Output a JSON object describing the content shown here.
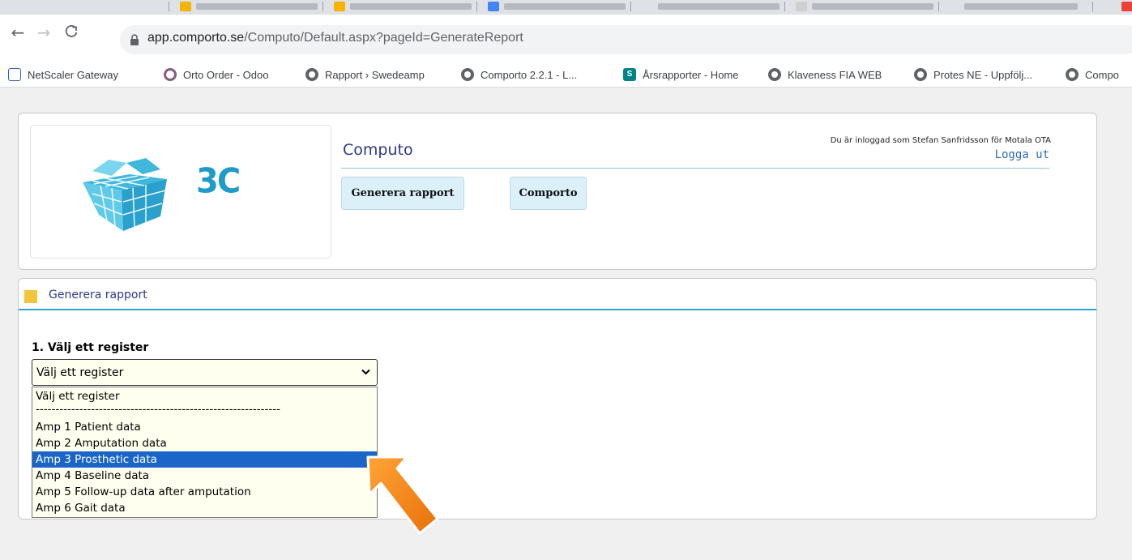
{
  "browser": {
    "url_host": "app.comporto.se",
    "url_path": "/Computo/Default.aspx?pageId=GenerateReport",
    "bookmarks": [
      {
        "label": "NetScaler Gateway",
        "icon": "netscaler-lock-icon"
      },
      {
        "label": "Orto Order - Odoo",
        "icon": "odoo-icon"
      },
      {
        "label": "Rapport › Swedeamp",
        "icon": "globe-icon"
      },
      {
        "label": "Comporto 2.2.1 - L...",
        "icon": "globe-icon"
      },
      {
        "label": "Årsrapporter - Home",
        "icon": "sharepoint-icon"
      },
      {
        "label": "Klaveness FIA WEB",
        "icon": "globe-icon"
      },
      {
        "label": "Protes NE - Uppfölj...",
        "icon": "globe-icon"
      },
      {
        "label": "Compo",
        "icon": "globe-icon"
      }
    ]
  },
  "header": {
    "logo_text": "3C",
    "app_title": "Computo",
    "login_info": "Du är inloggad som Stefan Sanfridsson för Motala OTA",
    "logout_label": "Logga ut",
    "nav": [
      {
        "label": "Generera rapport"
      },
      {
        "label": "Comporto"
      }
    ]
  },
  "report": {
    "panel_title": "Generera rapport",
    "step_label": "1. Välj ett register",
    "select_value": "Välj ett register",
    "options": [
      "Välj ett register",
      "--------------------------------------------------------------",
      "Amp 1 Patient data",
      "Amp 2 Amputation data",
      "Amp 3 Prosthetic data",
      "Amp 4 Baseline data",
      "Amp 5 Follow-up data after amputation",
      "Amp 6 Gait data"
    ],
    "highlighted_option": "Amp 3 Prosthetic data"
  },
  "colors": {
    "accent_blue": "#2fa3d9",
    "title_blue": "#2b3a8a",
    "highlight": "#1a65c7",
    "arrow_orange": "#f07f0c",
    "panel_square": "#f2c53d"
  }
}
